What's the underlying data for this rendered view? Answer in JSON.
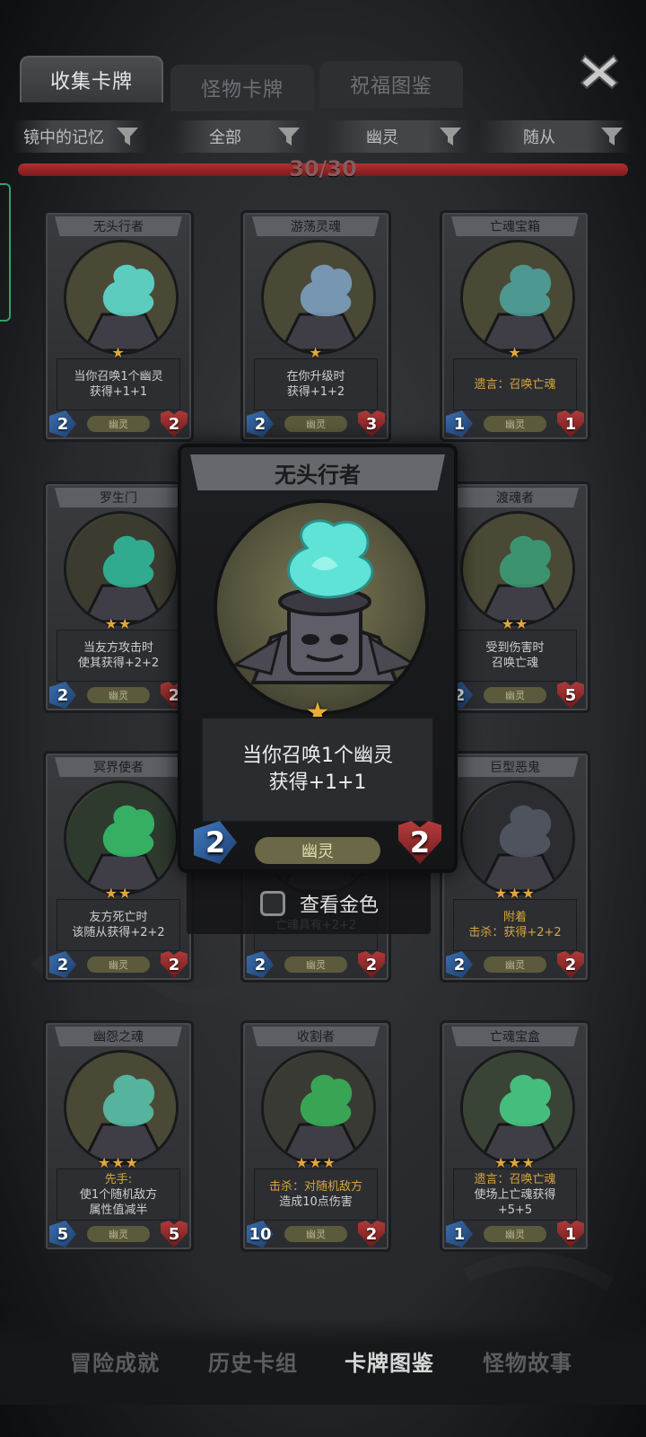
{
  "tabs": [
    {
      "label": "收集卡牌",
      "active": true
    },
    {
      "label": "怪物卡牌",
      "active": false
    },
    {
      "label": "祝福图鉴",
      "active": false
    }
  ],
  "close_icon": "close-x-icon",
  "filters": [
    {
      "label": "镜中的记忆"
    },
    {
      "label": "全部"
    },
    {
      "label": "幽灵"
    },
    {
      "label": "随从"
    }
  ],
  "progress": {
    "text": "30/30",
    "fraction": 1.0
  },
  "colors": {
    "accent_red": "#9a2626",
    "star": "#e0a83a",
    "attack": "#2f5e9e",
    "health": "#8e2a2a"
  },
  "cards": [
    {
      "name": "无头行者",
      "stars": "★",
      "desc": [
        "当你召唤1个幽灵",
        "获得+1+1"
      ],
      "tribe": "幽灵",
      "attack": "2",
      "health": "2"
    },
    {
      "name": "游荡灵魂",
      "stars": "★",
      "desc": [
        "在你升级时",
        "获得+1+2"
      ],
      "tribe": "幽灵",
      "attack": "2",
      "health": "3"
    },
    {
      "name": "亡魂宝箱",
      "stars": "★",
      "desc": [
        "遗言：召唤亡魂"
      ],
      "tribe": "幽灵",
      "attack": "1",
      "health": "1"
    },
    {
      "name": "罗生门",
      "stars": "★★",
      "desc": [
        "当友方攻击时",
        "使其获得+2+2"
      ],
      "tribe": "幽灵",
      "attack": "2",
      "health": "2"
    },
    {
      "name": "渡魂者",
      "stars": "★★",
      "desc": [
        "受到伤害时",
        "召唤亡魂"
      ],
      "tribe": "幽灵",
      "attack": "2",
      "health": "5"
    },
    {
      "name": "冥界使者",
      "stars": "★★",
      "desc": [
        "友方死亡时",
        "该随从获得+2+2"
      ],
      "tribe": "幽灵",
      "attack": "2",
      "health": "2"
    },
    {
      "name": "",
      "stars": "",
      "desc": [
        "亡魂具有+2+2"
      ],
      "tribe": "幽灵",
      "attack": "2",
      "health": "2"
    },
    {
      "name": "巨型恶鬼",
      "stars": "★★★",
      "desc": [
        "附着",
        "击杀：获得+2+2"
      ],
      "tribe": "幽灵",
      "attack": "2",
      "health": "2"
    },
    {
      "name": "幽怨之魂",
      "stars": "★★★",
      "desc": [
        "先手:",
        "使1个随机敌方",
        "属性值减半"
      ],
      "tribe": "幽灵",
      "attack": "5",
      "health": "5"
    },
    {
      "name": "收割者",
      "stars": "★★★",
      "desc": [
        "击杀：对随机敌方",
        "造成10点伤害"
      ],
      "tribe": "幽灵",
      "attack": "10",
      "health": "2"
    },
    {
      "name": "亡魂宝盒",
      "stars": "★★★",
      "desc": [
        "遗言：召唤亡魂",
        "使场上亡魂获得",
        "+5+5"
      ],
      "tribe": "幽灵",
      "attack": "1",
      "health": "1"
    }
  ],
  "popup": {
    "name": "无头行者",
    "star": "★",
    "desc_line1": "当你召唤1个幽灵",
    "desc_line2": "获得+1+1",
    "tribe": "幽灵",
    "attack": "2",
    "health": "2"
  },
  "gold_toggle": {
    "label": "查看金色",
    "checked": false
  },
  "bottom_nav": [
    {
      "label": "冒险成就",
      "active": false
    },
    {
      "label": "历史卡组",
      "active": false
    },
    {
      "label": "卡牌图鉴",
      "active": true
    },
    {
      "label": "怪物故事",
      "active": false
    }
  ]
}
